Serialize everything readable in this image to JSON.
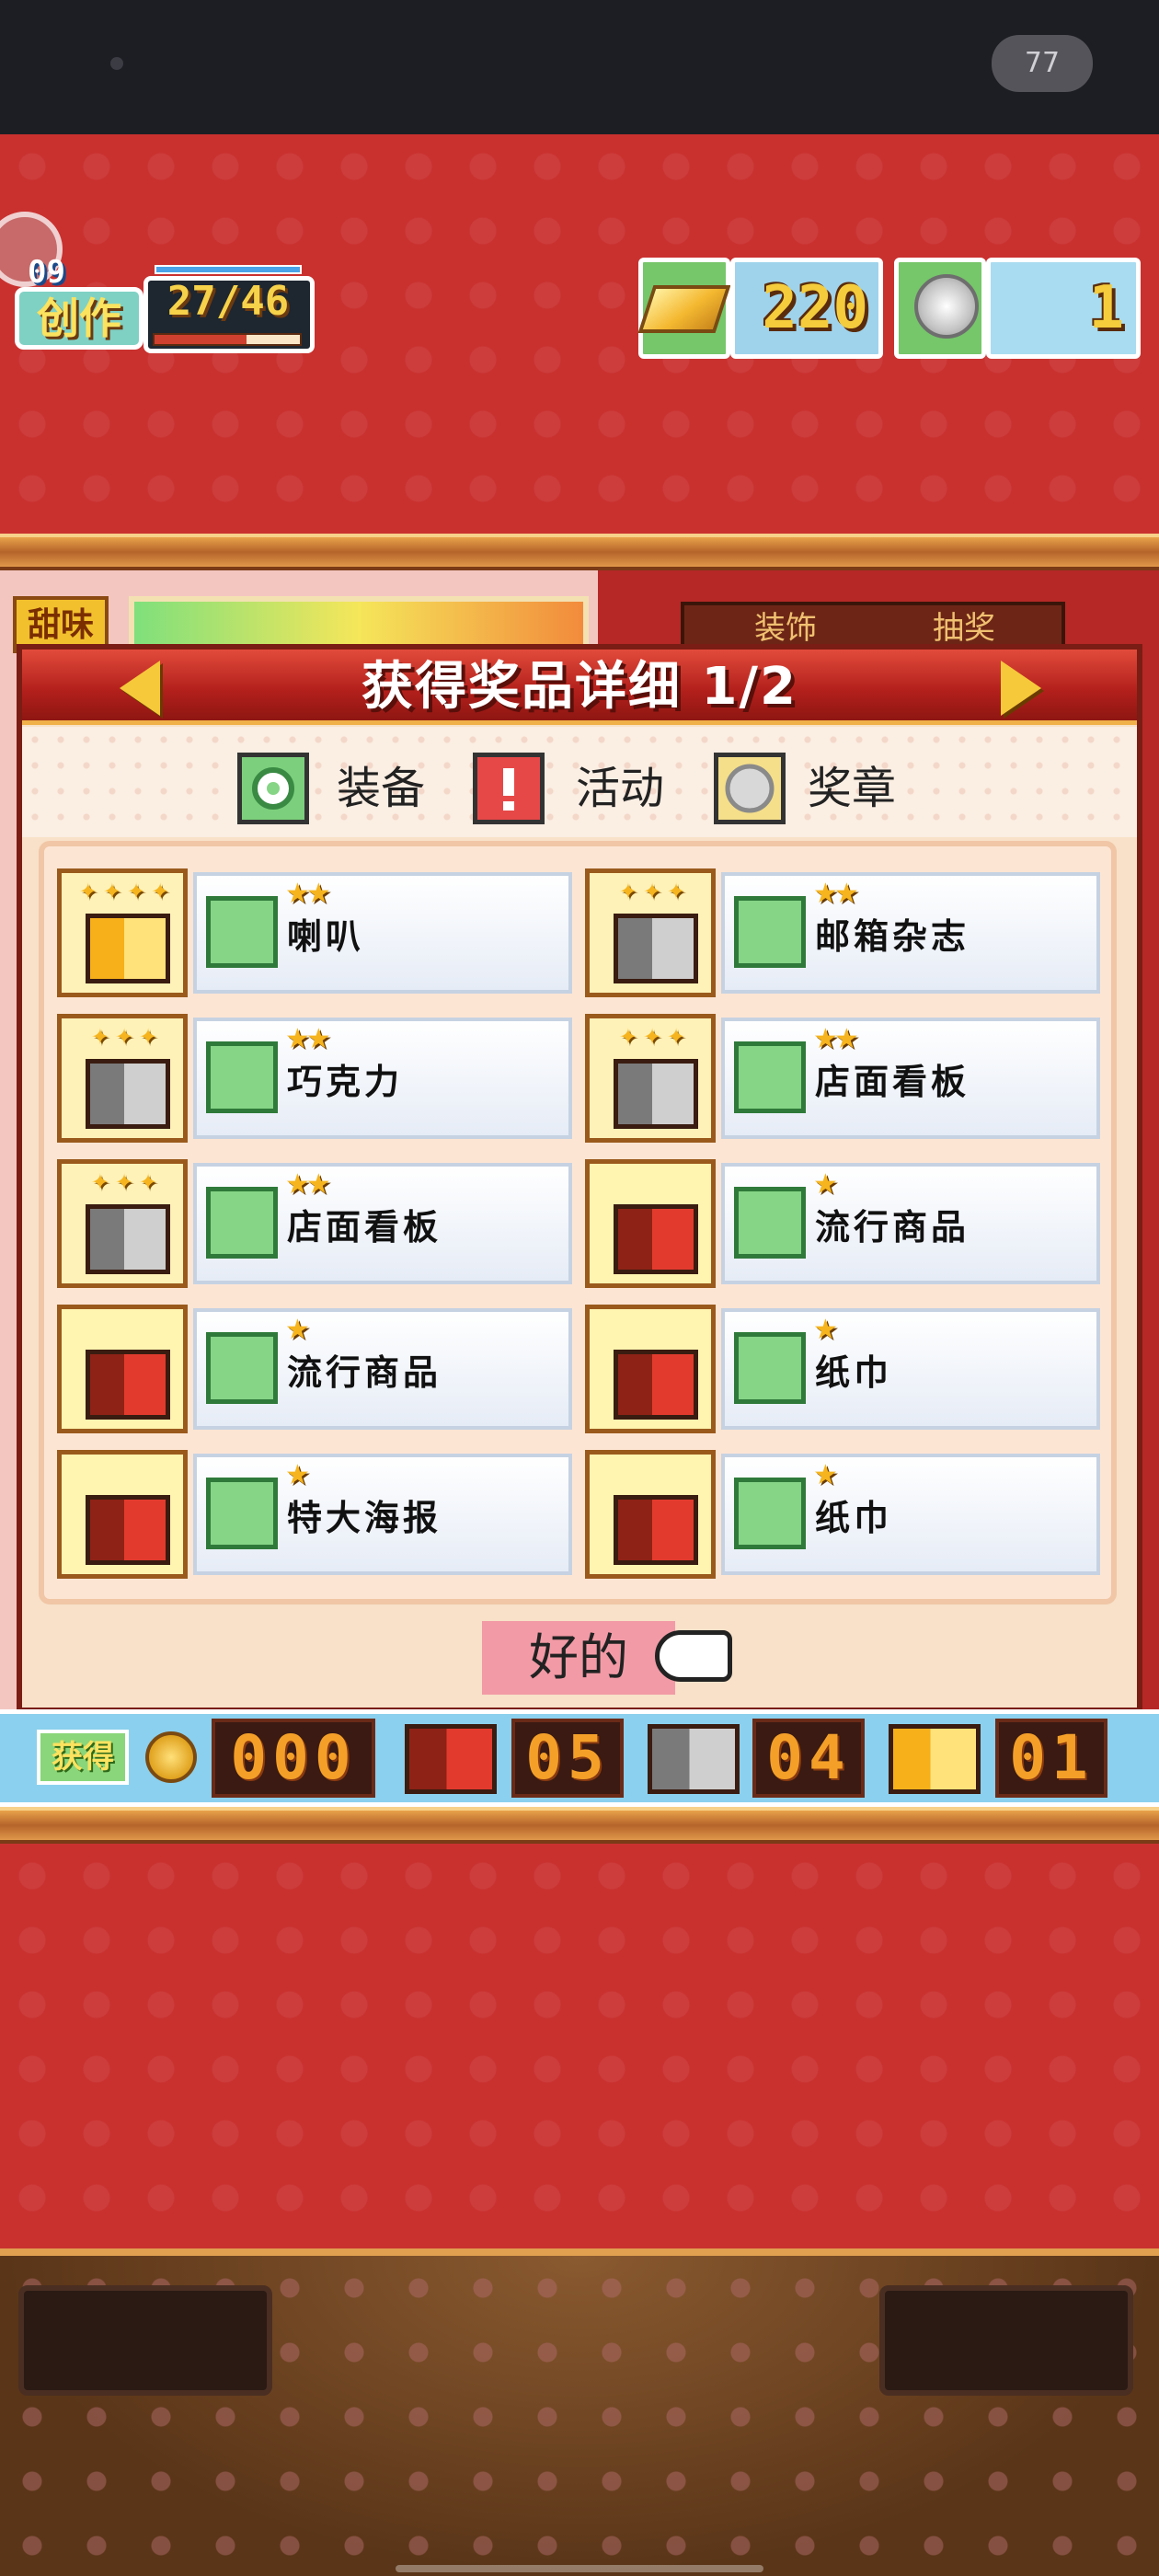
{
  "status_bar": {
    "badge": "77"
  },
  "hud": {
    "level": "09",
    "tag": "创作",
    "count": "27/46",
    "gold": "220",
    "medals": "1"
  },
  "background": {
    "side_label": "甜味",
    "tab_left": "装饰",
    "tab_right": "抽奖"
  },
  "dialog": {
    "title": "获得奖品详细 1/2",
    "legend": [
      {
        "icon": "gear-icon",
        "label": "装备"
      },
      {
        "icon": "alert-icon",
        "label": "活动"
      },
      {
        "icon": "medal-icon",
        "label": "奖章"
      }
    ],
    "prizes": [
      {
        "name": "喇叭",
        "stars": "★★",
        "chest": "gold"
      },
      {
        "name": "邮箱杂志",
        "stars": "★★",
        "chest": "silver"
      },
      {
        "name": "巧克力",
        "stars": "★★",
        "chest": "silver"
      },
      {
        "name": "店面看板",
        "stars": "★★",
        "chest": "silver"
      },
      {
        "name": "店面看板",
        "stars": "★★",
        "chest": "silver"
      },
      {
        "name": "流行商品",
        "stars": "★",
        "chest": "red"
      },
      {
        "name": "流行商品",
        "stars": "★",
        "chest": "red"
      },
      {
        "name": "纸巾",
        "stars": "★",
        "chest": "red"
      },
      {
        "name": "特大海报",
        "stars": "★",
        "chest": "red"
      },
      {
        "name": "纸巾",
        "stars": "★",
        "chest": "red"
      }
    ],
    "ok_label": "好的"
  },
  "counter": {
    "label": "获得",
    "coins": "000",
    "red_chests": "05",
    "silver_chests": "04",
    "gold_chests": "01"
  },
  "colors": {
    "background_red": "#c9312f",
    "dialog_header": "#b11f1b",
    "star": "#f6b51e",
    "digits": "#f4a028"
  }
}
